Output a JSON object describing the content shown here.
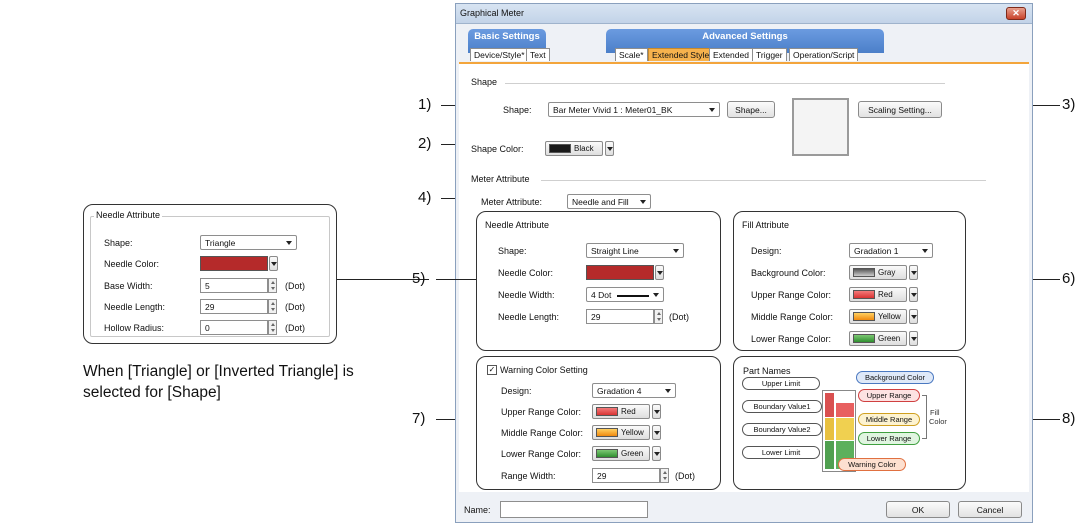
{
  "window": {
    "title": "Graphical Meter",
    "close_glyph": "✕"
  },
  "tab_groups": [
    {
      "label": "Basic Settings",
      "color": "#5d8ed0"
    },
    {
      "label": "Advanced Settings",
      "color": "#5d8ed0"
    }
  ],
  "tabs": [
    "Device/Style*",
    "Text",
    "Scale*",
    "Extended Style*",
    "Extended",
    "Trigger",
    "Operation/Script"
  ],
  "active_tab": "Extended Style*",
  "shape_section": {
    "title": "Shape",
    "shape_label": "Shape:",
    "shape_value": "Bar Meter Vivid 1 : Meter01_BK",
    "shape_button": "Shape...",
    "scaling_button": "Scaling Setting...",
    "color_label": "Shape Color:",
    "color_value": "Black",
    "color_swatch": "#1a1a1a"
  },
  "meter_section": {
    "title": "Meter Attribute",
    "attr_label": "Meter Attribute:",
    "attr_value": "Needle and Fill"
  },
  "needle": {
    "title": "Needle Attribute",
    "shape_label": "Shape:",
    "shape_value": "Straight Line",
    "color_label": "Needle Color:",
    "color_swatch": "#b52a2a",
    "width_label": "Needle Width:",
    "width_value": "4 Dot",
    "length_label": "Needle Length:",
    "length_value": "29",
    "unit": "(Dot)"
  },
  "fill": {
    "title": "Fill Attribute",
    "design_label": "Design:",
    "design_value": "Gradation 1",
    "rows": [
      {
        "label": "Background Color:",
        "value": "Gray",
        "swatch": "#8a8a8a"
      },
      {
        "label": "Upper Range Color:",
        "value": "Red",
        "swatch": "#e04848"
      },
      {
        "label": "Middle Range Color:",
        "value": "Yellow",
        "swatch": "#f0a020"
      },
      {
        "label": "Lower Range Color:",
        "value": "Green",
        "swatch": "#3ca040"
      }
    ]
  },
  "warning": {
    "checkbox_glyph": "✓",
    "title": "Warning Color Setting",
    "design_label": "Design:",
    "design_value": "Gradation 4",
    "rows": [
      {
        "label": "Upper Range Color:",
        "value": "Red",
        "swatch": "#e04848"
      },
      {
        "label": "Middle Range Color:",
        "value": "Yellow",
        "swatch": "#f0a020"
      },
      {
        "label": "Lower Range Color:",
        "value": "Green",
        "swatch": "#3ca040"
      }
    ],
    "range_label": "Range Width:",
    "range_value": "29",
    "unit": "(Dot)"
  },
  "part_names": {
    "title": "Part Names",
    "left": [
      "Upper Limit",
      "Boundary Value1",
      "Boundary Value2",
      "Lower Limit"
    ],
    "right": [
      "Background Color",
      "Upper Range",
      "Middle Range",
      "Lower Range",
      "Warning Color"
    ],
    "fill_color": "Fill\nColor",
    "fill_word1": "Fill",
    "fill_word2": "Color"
  },
  "footer": {
    "name_label": "Name:",
    "ok": "OK",
    "cancel": "Cancel"
  },
  "callouts": [
    "1)",
    "2)",
    "3)",
    "4)",
    "5)",
    "6)",
    "7)",
    "8)"
  ],
  "left_panel": {
    "title": "Needle Attribute",
    "shape_label": "Shape:",
    "shape_value": "Triangle",
    "color_label": "Needle Color:",
    "color_swatch": "#b52a2a",
    "base_label": "Base Width:",
    "base_value": "5",
    "length_label": "Needle Length:",
    "length_value": "29",
    "hollow_label": "Hollow Radius:",
    "hollow_value": "0",
    "unit": "(Dot)",
    "caption_line1": "When [Triangle] or [Inverted Triangle] is",
    "caption_line2": "selected for [Shape]"
  }
}
